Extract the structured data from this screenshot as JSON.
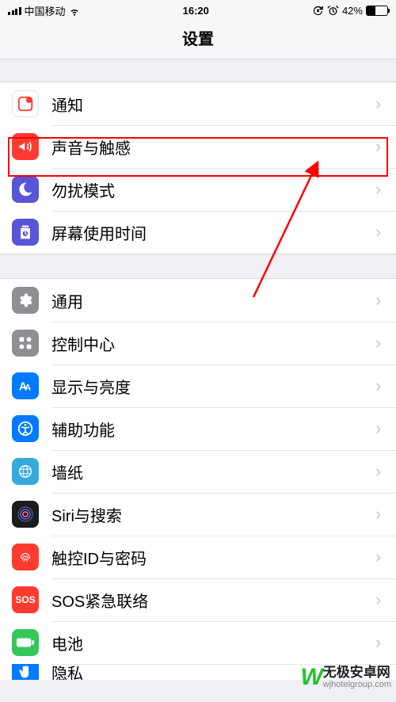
{
  "status": {
    "carrier": "中国移动",
    "time": "16:20",
    "battery_pct": "42%"
  },
  "title": "设置",
  "group1": [
    {
      "label": "通知"
    },
    {
      "label": "声音与触感"
    },
    {
      "label": "勿扰模式"
    },
    {
      "label": "屏幕使用时间"
    }
  ],
  "group2": [
    {
      "label": "通用"
    },
    {
      "label": "控制中心"
    },
    {
      "label": "显示与亮度"
    },
    {
      "label": "辅助功能"
    },
    {
      "label": "墙纸"
    },
    {
      "label": "Siri与搜索"
    },
    {
      "label": "触控ID与密码"
    },
    {
      "label": "SOS紧急联络"
    },
    {
      "label": "电池"
    },
    {
      "label": "隐私"
    }
  ],
  "sos_text": "SOS",
  "watermark": {
    "brand": "无极安卓网",
    "url": "wjhotelgroup.com"
  }
}
